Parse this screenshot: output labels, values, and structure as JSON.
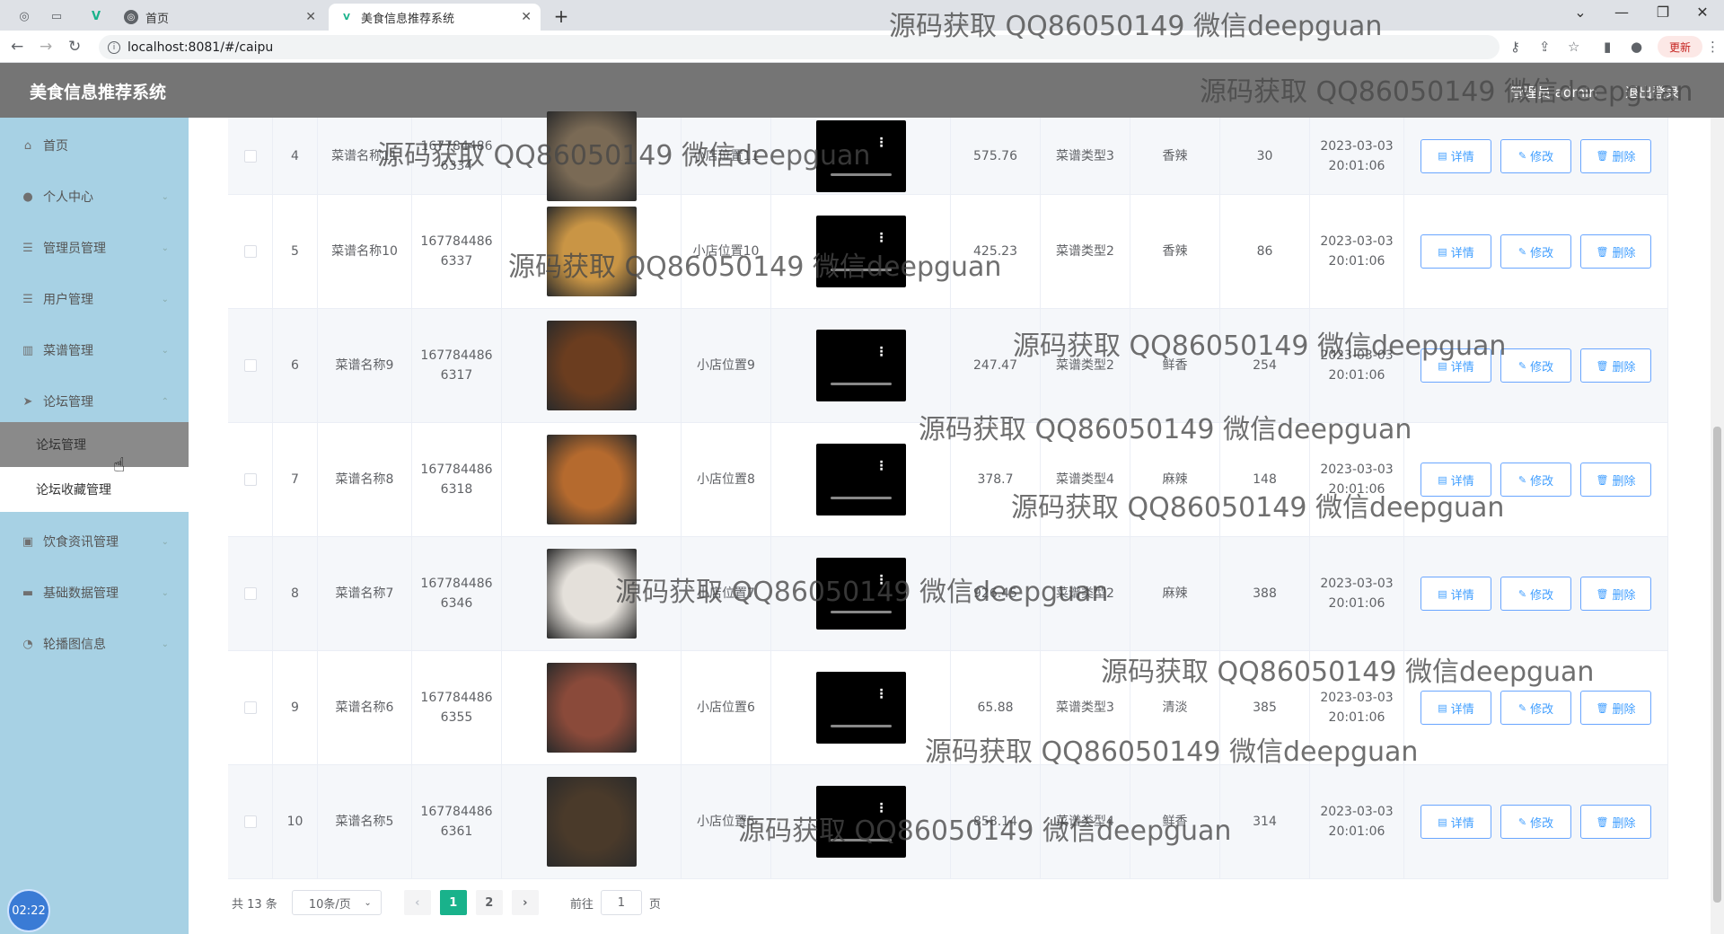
{
  "browser": {
    "tabs": [
      {
        "title": "首页",
        "active": false
      },
      {
        "title": "美食信息推荐系统",
        "active": true
      }
    ],
    "url": "localhost:8081/#/caipu",
    "update_label": "更新"
  },
  "header": {
    "title": "美食信息推荐系统",
    "user_label": "管理员 admin",
    "logout_label": "退出登录"
  },
  "sidebar": {
    "items": [
      {
        "label": "首页",
        "icon": "home-icon",
        "arrow": ""
      },
      {
        "label": "个人中心",
        "icon": "user-icon",
        "arrow": "⌄"
      },
      {
        "label": "管理员管理",
        "icon": "list-icon",
        "arrow": "⌄"
      },
      {
        "label": "用户管理",
        "icon": "list-icon",
        "arrow": "⌄"
      },
      {
        "label": "菜谱管理",
        "icon": "chart-icon",
        "arrow": "⌄"
      },
      {
        "label": "论坛管理",
        "icon": "send-icon",
        "arrow": "⌃"
      },
      {
        "label": "饮食资讯管理",
        "icon": "briefcase-icon",
        "arrow": "⌄"
      },
      {
        "label": "基础数据管理",
        "icon": "monitor-icon",
        "arrow": "⌄"
      },
      {
        "label": "轮播图信息",
        "icon": "gauge-icon",
        "arrow": "⌄"
      }
    ],
    "subitems": [
      {
        "label": "论坛管理",
        "active": true
      },
      {
        "label": "论坛收藏管理",
        "active": false
      }
    ],
    "clock": "02:22"
  },
  "table": {
    "buttons": {
      "detail": "详情",
      "edit": "修改",
      "delete": "删除"
    },
    "rows": [
      {
        "idx": "4",
        "name": "菜谱名称11",
        "code1": "167784486",
        "code2": "6334",
        "shop": "小店位置11",
        "price": "575.76",
        "type": "菜谱类型3",
        "taste": "香辣",
        "count": "30",
        "date": "2023-03-03",
        "time": "20:01:06",
        "img_color": "#7a6a55"
      },
      {
        "idx": "5",
        "name": "菜谱名称10",
        "code1": "167784486",
        "code2": "6337",
        "shop": "小店位置10",
        "price": "425.23",
        "type": "菜谱类型2",
        "taste": "香辣",
        "count": "86",
        "date": "2023-03-03",
        "time": "20:01:06",
        "img_color": "#c99545"
      },
      {
        "idx": "6",
        "name": "菜谱名称9",
        "code1": "167784486",
        "code2": "6317",
        "shop": "小店位置9",
        "price": "247.47",
        "type": "菜谱类型2",
        "taste": "鲜香",
        "count": "254",
        "date": "2023-03-03",
        "time": "20:01:06",
        "img_color": "#6b3d1f"
      },
      {
        "idx": "7",
        "name": "菜谱名称8",
        "code1": "167784486",
        "code2": "6318",
        "shop": "小店位置8",
        "price": "378.7",
        "type": "菜谱类型4",
        "taste": "麻辣",
        "count": "148",
        "date": "2023-03-03",
        "time": "20:01:06",
        "img_color": "#b56a2e"
      },
      {
        "idx": "8",
        "name": "菜谱名称7",
        "code1": "167784486",
        "code2": "6346",
        "shop": "小店位置7",
        "price": "926.45",
        "type": "菜谱类型2",
        "taste": "麻辣",
        "count": "388",
        "date": "2023-03-03",
        "time": "20:01:06",
        "img_color": "#e4e0da"
      },
      {
        "idx": "9",
        "name": "菜谱名称6",
        "code1": "167784486",
        "code2": "6355",
        "shop": "小店位置6",
        "price": "65.88",
        "type": "菜谱类型3",
        "taste": "清淡",
        "count": "385",
        "date": "2023-03-03",
        "time": "20:01:06",
        "img_color": "#8a4a3a"
      },
      {
        "idx": "10",
        "name": "菜谱名称5",
        "code1": "167784486",
        "code2": "6361",
        "shop": "小店位置5",
        "price": "858.14",
        "type": "菜谱类型4",
        "taste": "鲜香",
        "count": "314",
        "date": "2023-03-03",
        "time": "20:01:06",
        "img_color": "#4a3a2a"
      }
    ]
  },
  "pagination": {
    "total": "共 13 条",
    "page_size": "10条/页",
    "pages": [
      "1",
      "2"
    ],
    "current": "1",
    "goto_prefix": "前往",
    "goto_value": "1",
    "goto_suffix": "页"
  },
  "watermark": "源码获取 QQ86050149 微信deepguan",
  "colors": {
    "accent": "#409eff",
    "pager_active": "#19b28b",
    "sidebar_bg": "#a7d1e4",
    "header_bg": "#757575"
  }
}
